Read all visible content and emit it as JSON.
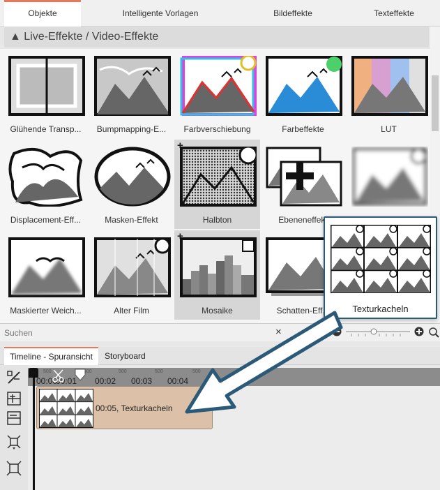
{
  "tabs": [
    "Objekte",
    "Intelligente Vorlagen",
    "Bildeffekte",
    "Texteffekte"
  ],
  "section_title": "▲ Live-Effekte / Video-Effekte",
  "effects": [
    {
      "label": "Glühende Transp..."
    },
    {
      "label": "Bumpmapping-E..."
    },
    {
      "label": "Farbverschiebung"
    },
    {
      "label": "Farbeffekte"
    },
    {
      "label": "LUT"
    },
    {
      "label": "Displacement-Eff..."
    },
    {
      "label": "Masken-Effekt"
    },
    {
      "label": "Halbton"
    },
    {
      "label": "Ebeneneffekt"
    },
    {
      "label": ""
    },
    {
      "label": "Maskierter Weich..."
    },
    {
      "label": "Alter Film"
    },
    {
      "label": "Mosaike"
    },
    {
      "label": "Schatten-Eff..."
    },
    {
      "label": ""
    }
  ],
  "popup": {
    "label": "Texturkacheln"
  },
  "search": {
    "placeholder": "Suchen",
    "clear": "×"
  },
  "timeline_tabs": [
    "Timeline - Spuransicht",
    "Storyboard"
  ],
  "ruler": {
    "labels": [
      "00:00",
      "00:01",
      "00:02",
      "00:03",
      "00:04"
    ],
    "sublabels": [
      "500",
      "500",
      "500",
      "500",
      "500"
    ]
  },
  "clip": {
    "label": "00:05, Texturkacheln"
  },
  "colors": {
    "accent": "#e8785a",
    "popup_border": "#2a5a78",
    "clip": "#dcc1a8",
    "arrow": "#2a5a78"
  }
}
